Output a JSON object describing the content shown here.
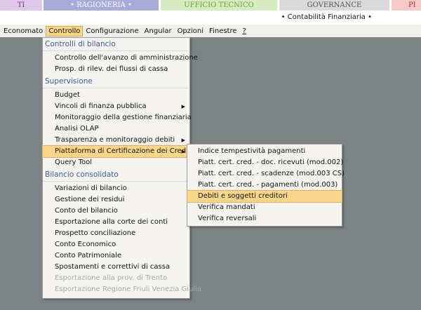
{
  "top_tabs": [
    {
      "label": "TI",
      "color": "#e0c8e8",
      "text": "#7a3a8a"
    },
    {
      "label": "• RAGIONERIA •",
      "color": "#a8aad8",
      "text": "#ffffff"
    },
    {
      "label": "UFFICIO TECNICO",
      "color": "#d6ebbf",
      "text": "#6aa030"
    },
    {
      "label": "GOVERNANCE",
      "color": "#d9d9d9",
      "text": "#555555"
    },
    {
      "label": "PI",
      "color": "#f7c9c9",
      "text": "#c03030"
    }
  ],
  "context_title": "• Contabilità Finanziaria •",
  "menubar": [
    "Economato",
    "Controllo",
    "Configurazione",
    "Angular",
    "Opzioni",
    "Finestre",
    "?"
  ],
  "menu": {
    "sections": [
      {
        "title": "Controlli di bilancio",
        "items": [
          {
            "label": "Controllo dell'avanzo di amministrazione"
          },
          {
            "label": "Prosp. di rilev. dei flussi di cassa"
          }
        ]
      },
      {
        "title": "Supervisione",
        "items": [
          {
            "label": "Budget"
          },
          {
            "label": "Vincoli di finanza pubblica",
            "submenu": true
          },
          {
            "label": "Monitoraggio della gestione finanziaria"
          },
          {
            "label": "Analisi OLAP"
          },
          {
            "label": "Trasparenza e monitoraggio debiti",
            "submenu": true
          },
          {
            "label": "Piattaforma di Certificazione dei Crediti",
            "submenu": true,
            "highlighted": true
          },
          {
            "label": "Query Tool"
          }
        ]
      },
      {
        "title": "Bilancio consolidato",
        "items": [
          {
            "label": "Variazioni di bilancio"
          },
          {
            "label": "Gestione dei residui"
          },
          {
            "label": "Conto del bilancio"
          },
          {
            "label": "Esportazione alla corte dei conti"
          },
          {
            "label": "Prospetto conciliazione"
          },
          {
            "label": "Conto Economico"
          },
          {
            "label": "Conto Patrimoniale"
          },
          {
            "label": "Spostamenti e correttivi di cassa"
          },
          {
            "label": "Esportazione alla prov. di Trento",
            "disabled": true
          },
          {
            "label": "Esportazione Regione Friuli Venezia Giulia",
            "disabled": true
          }
        ]
      }
    ]
  },
  "submenu": [
    "Indice tempestività pagamenti",
    "Piatt. cert. cred. - doc. ricevuti (mod.002)",
    "Piatt. cert. cred. - scadenze (mod.003 CS)",
    "Piatt. cert. cred. - pagamenti (mod.003)",
    "Debiti e soggetti creditori",
    "Verifica mandati",
    "Verifica reversali"
  ],
  "submenu_highlighted": "Debiti e soggetti creditori"
}
